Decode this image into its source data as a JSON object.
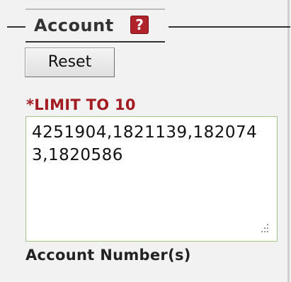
{
  "section": {
    "title": "Account",
    "help_icon": "question-mark-icon",
    "help_glyph": "?",
    "accent_color": "#b1232a"
  },
  "reset_button": {
    "label": "Reset"
  },
  "limit_note": {
    "text": "*LIMIT TO 10",
    "color": "#a31c22"
  },
  "account_numbers": {
    "value": "4251904,1821139,1820743,1820586"
  },
  "account_numbers_label": "Account Number(s)"
}
